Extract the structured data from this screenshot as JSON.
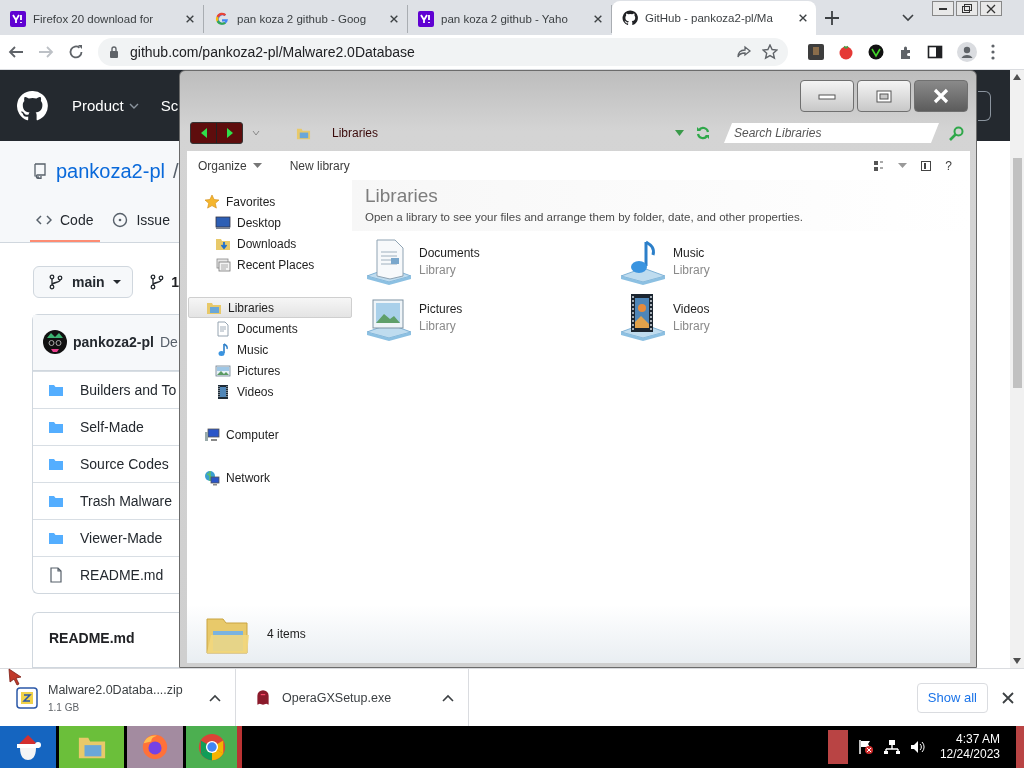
{
  "browser": {
    "tabs": [
      {
        "kind": "yahoo",
        "title": "Firefox 20 download for",
        "selected": false
      },
      {
        "kind": "google",
        "title": "pan koza 2 github - Goog",
        "selected": false
      },
      {
        "kind": "yahoo",
        "title": "pan koza 2 github - Yaho",
        "selected": false
      },
      {
        "kind": "github",
        "title": "GitHub - pankoza2-pl/Ma",
        "selected": true
      }
    ],
    "forward_disabled": true,
    "url": "github.com/pankoza2-pl/Malware2.0Database"
  },
  "github": {
    "nav": [
      "Product",
      "Sc"
    ],
    "owner": "pankoza2-pl",
    "separator": "/",
    "tabs": [
      {
        "label": "Code",
        "selected": true
      },
      {
        "label": "Issue",
        "selected": false
      }
    ],
    "branch": "main",
    "branch_count": "1",
    "commit": {
      "author": "pankoza2-pl",
      "message": "De"
    },
    "files": [
      {
        "name": "Builders and To",
        "kind": "folder"
      },
      {
        "name": "Self-Made",
        "kind": "folder"
      },
      {
        "name": "Source Codes",
        "kind": "folder"
      },
      {
        "name": "Trash Malware",
        "kind": "folder"
      },
      {
        "name": "Viewer-Made",
        "kind": "folder"
      },
      {
        "name": "README.md",
        "kind": "file"
      }
    ],
    "readme_title": "README.md"
  },
  "explorer": {
    "location": "Libraries",
    "search_placeholder": "Search Libraries",
    "toolbar": [
      "Organize",
      "New library"
    ],
    "help": "?",
    "nav": [
      {
        "label": "Favorites",
        "kind": "star",
        "selected": false,
        "children": [
          {
            "label": "Desktop",
            "kind": "desktop",
            "selected": false
          },
          {
            "label": "Downloads",
            "kind": "downloads",
            "selected": false
          },
          {
            "label": "Recent Places",
            "kind": "recent",
            "selected": false
          }
        ]
      },
      {
        "label": "Libraries",
        "kind": "libraries",
        "selected": true,
        "children": [
          {
            "label": "Documents",
            "kind": "documents",
            "selected": false
          },
          {
            "label": "Music",
            "kind": "music",
            "selected": false
          },
          {
            "label": "Pictures",
            "kind": "pictures",
            "selected": false
          },
          {
            "label": "Videos",
            "kind": "videos",
            "selected": false
          }
        ]
      },
      {
        "label": "Computer",
        "kind": "computer",
        "selected": false
      },
      {
        "label": "Network",
        "kind": "network",
        "selected": false
      }
    ],
    "heading": "Libraries",
    "description": "Open a library to see your files and arrange them by folder, date, and other properties.",
    "items": [
      {
        "name": "Documents",
        "type": "Library",
        "kind": "documents"
      },
      {
        "name": "Music",
        "type": "Library",
        "kind": "music"
      },
      {
        "name": "Pictures",
        "type": "Library",
        "kind": "pictures"
      },
      {
        "name": "Videos",
        "type": "Library",
        "kind": "videos"
      }
    ],
    "status": "4 items"
  },
  "downloads": {
    "items": [
      {
        "name": "Malware2.0Databa....zip",
        "size": "1.1 GB",
        "kind": "zip"
      },
      {
        "name": "OperaGXSetup.exe",
        "kind": "opera"
      }
    ],
    "show_all": "Show all"
  },
  "taskbar": {
    "time": "4:37 AM",
    "date": "12/24/2023"
  }
}
